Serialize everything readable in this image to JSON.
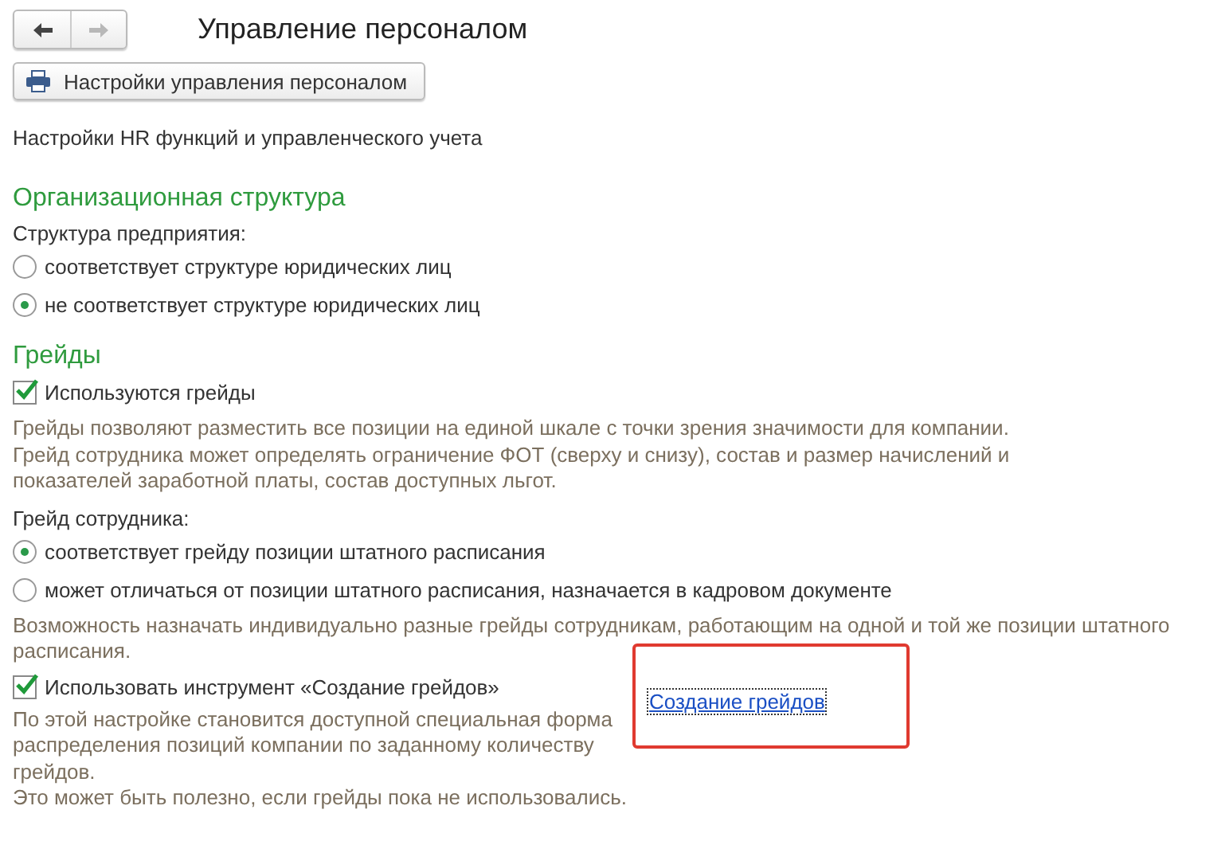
{
  "window": {
    "title": "Управление персоналом",
    "nav": [
      {
        "kind": "back",
        "disabled": false
      },
      {
        "kind": "forward",
        "disabled": true
      }
    ]
  },
  "toolbar": {
    "button": "Настройки управления персоналом"
  },
  "intro": "Настройки HR функций и управленческого учета",
  "sections": [
    {
      "heading": "Организационная структура",
      "items": [
        {
          "kind": "label",
          "text": "Структура предприятия:"
        },
        {
          "kind": "radio",
          "text": "соответствует структуре юридических лиц",
          "selected": false
        },
        {
          "kind": "radio",
          "text": "не соответствует структуре юридических лиц",
          "selected": true
        }
      ]
    },
    {
      "heading": "Грейды",
      "items": [
        {
          "kind": "checkbox",
          "text": "Используются грейды",
          "checked": true
        },
        {
          "kind": "hint",
          "lines": [
            "Грейды позволяют разместить все позиции на единой шкале с точки зрения значимости для компании.",
            "Грейд сотрудника может определять ограничение ФОТ (сверху и снизу),  состав и размер начислений и",
            "показателей заработной платы, состав доступных льгот."
          ]
        },
        {
          "kind": "label",
          "text": "Грейд сотрудника:"
        },
        {
          "kind": "radio",
          "text": "соответствует грейду позиции штатного расписания",
          "selected": true
        },
        {
          "kind": "radio",
          "text": "может отличаться от позиции штатного расписания, назначается в кадровом документе",
          "selected": false
        },
        {
          "kind": "hint",
          "lines": [
            "Возможность назначать индивидуально разные грейды сотрудникам,  работающим на одной и той же позиции штатного",
            "расписания."
          ]
        },
        {
          "kind": "tool",
          "text": "Использовать инструмент «Создание грейдов»",
          "checked": true,
          "link": "Создание грейдов",
          "highlighted": true,
          "hint": [
            "По этой настройке становится доступной специальная форма",
            "распределения позиций компании по заданному количеству",
            "грейдов.",
            "Это может быть полезно, если грейды пока не использовались."
          ]
        }
      ]
    }
  ]
}
